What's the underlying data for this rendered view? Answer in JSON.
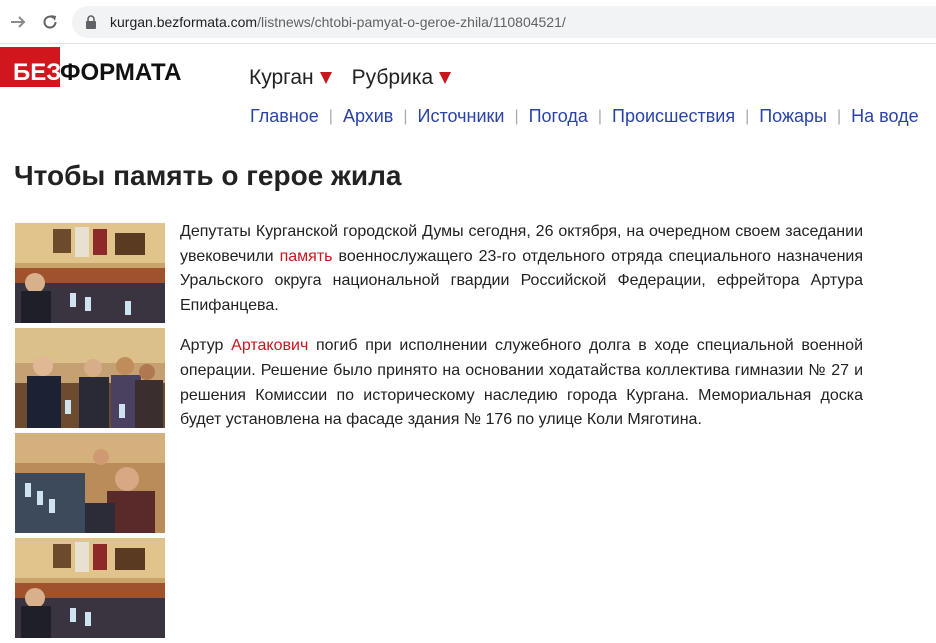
{
  "browser": {
    "url_host": "kurgan.bezformata.com",
    "url_path": "/listnews/chtobi-pamyat-o-geroe-zhila/110804521/"
  },
  "logo": {
    "part1": "БЕЗ",
    "part2": "ФОРМАТА"
  },
  "top_menu": {
    "city": "Курган",
    "rubric": "Рубрика"
  },
  "nav_links": [
    "Главное",
    "Архив",
    "Источники",
    "Погода",
    "Происшествия",
    "Пожары",
    "На воде"
  ],
  "page_title": "Чтобы память о герое жила",
  "article": {
    "p1_before": "Депутаты Курганской городской Думы сегодня, 26 октября, на очередном своем заседании увековечили ",
    "p1_link": "память",
    "p1_after": " военнослужащего 23-го отдельного отряда специального назначения Уральского округа национальной гвардии Российской Федерации, ефрейтора Артура Епифанцева.",
    "p2_before": "Артур ",
    "p2_link": "Артакович",
    "p2_after": " погиб при исполнении служебного долга в ходе специальной военной операции. Решение было принято на основании ходатайства коллектива гимназии № 27 и решения Комиссии по историческому наследию города Кургана. Мемориальная доска будет установлена на фасаде здания № 176 по улице Коли Мяготина."
  },
  "colors": {
    "brand_red": "#d2161e",
    "link_blue": "#2a43a8",
    "highlight_red": "#c8161d"
  }
}
